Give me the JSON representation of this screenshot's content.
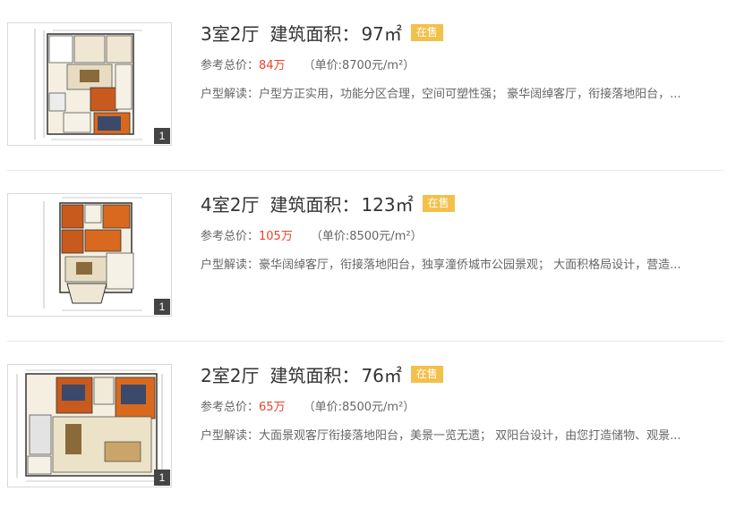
{
  "listings": [
    {
      "rooms": "3室2厅",
      "area_label": "建筑面积：",
      "area_value": "97㎡",
      "status": "在售",
      "price_label": "参考总价：",
      "price_value": "84万",
      "unit_price": "（单价:8700元/m²）",
      "desc_label": "户型解读：",
      "desc_text": "户型方正实用，功能分区合理，空间可塑性强； 豪华阔绰客厅，衔接落地阳台，...",
      "image_count": "1"
    },
    {
      "rooms": "4室2厅",
      "area_label": "建筑面积：",
      "area_value": "123㎡",
      "status": "在售",
      "price_label": "参考总价：",
      "price_value": "105万",
      "unit_price": "（单价:8500元/m²）",
      "desc_label": "户型解读：",
      "desc_text": "豪华阔绰客厅，衔接落地阳台，独享潼侨城市公园景观； 大面积格局设计，营造...",
      "image_count": "1"
    },
    {
      "rooms": "2室2厅",
      "area_label": "建筑面积：",
      "area_value": "76㎡",
      "status": "在售",
      "price_label": "参考总价：",
      "price_value": "65万",
      "unit_price": "（单价:8500元/m²）",
      "desc_label": "户型解读：",
      "desc_text": "大面景观客厅衔接落地阳台，美景一览无遗； 双阳台设计，由您打造储物、观景...",
      "image_count": "1"
    }
  ],
  "colors": {
    "price": "#e6442c",
    "badge": "#f2c04b"
  }
}
